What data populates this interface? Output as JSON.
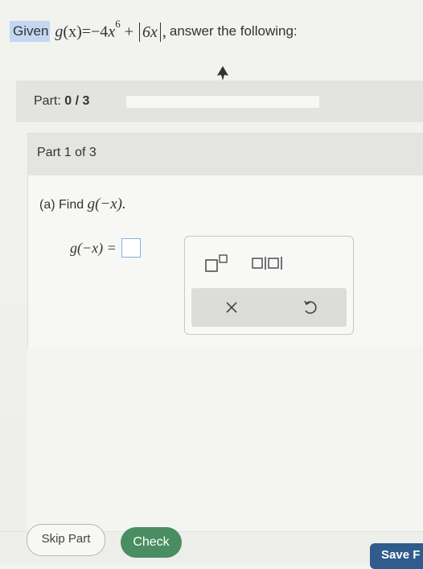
{
  "question": {
    "given_label": "Given",
    "function_lhs": "g",
    "function_arg": "(x)",
    "function_eq": "=−4",
    "function_var": "x",
    "exponent": "6",
    "plus": " +",
    "abs_content": "6x",
    "comma": ",",
    "rest": "answer the following:"
  },
  "part_bar": {
    "label": "Part:",
    "score": "0 / 3",
    "progress": 0
  },
  "part_card": {
    "header": "Part 1 of 3",
    "prompt_prefix": "(a) Find",
    "prompt_math": "g(−x).",
    "answer_lhs": "g(−x) ="
  },
  "palette": {
    "tools": [
      "superscript-icon",
      "absolute-value-icon"
    ],
    "actions": [
      "clear-icon",
      "undo-icon"
    ]
  },
  "footer": {
    "skip_label": "Skip Part",
    "check_label": "Check",
    "save_label": "Save F"
  },
  "colors": {
    "given_highlight": "#c3d7f1",
    "check_green": "#4a8d62",
    "save_blue": "#2f5c8c",
    "answer_box_border": "#7fb3e6"
  }
}
